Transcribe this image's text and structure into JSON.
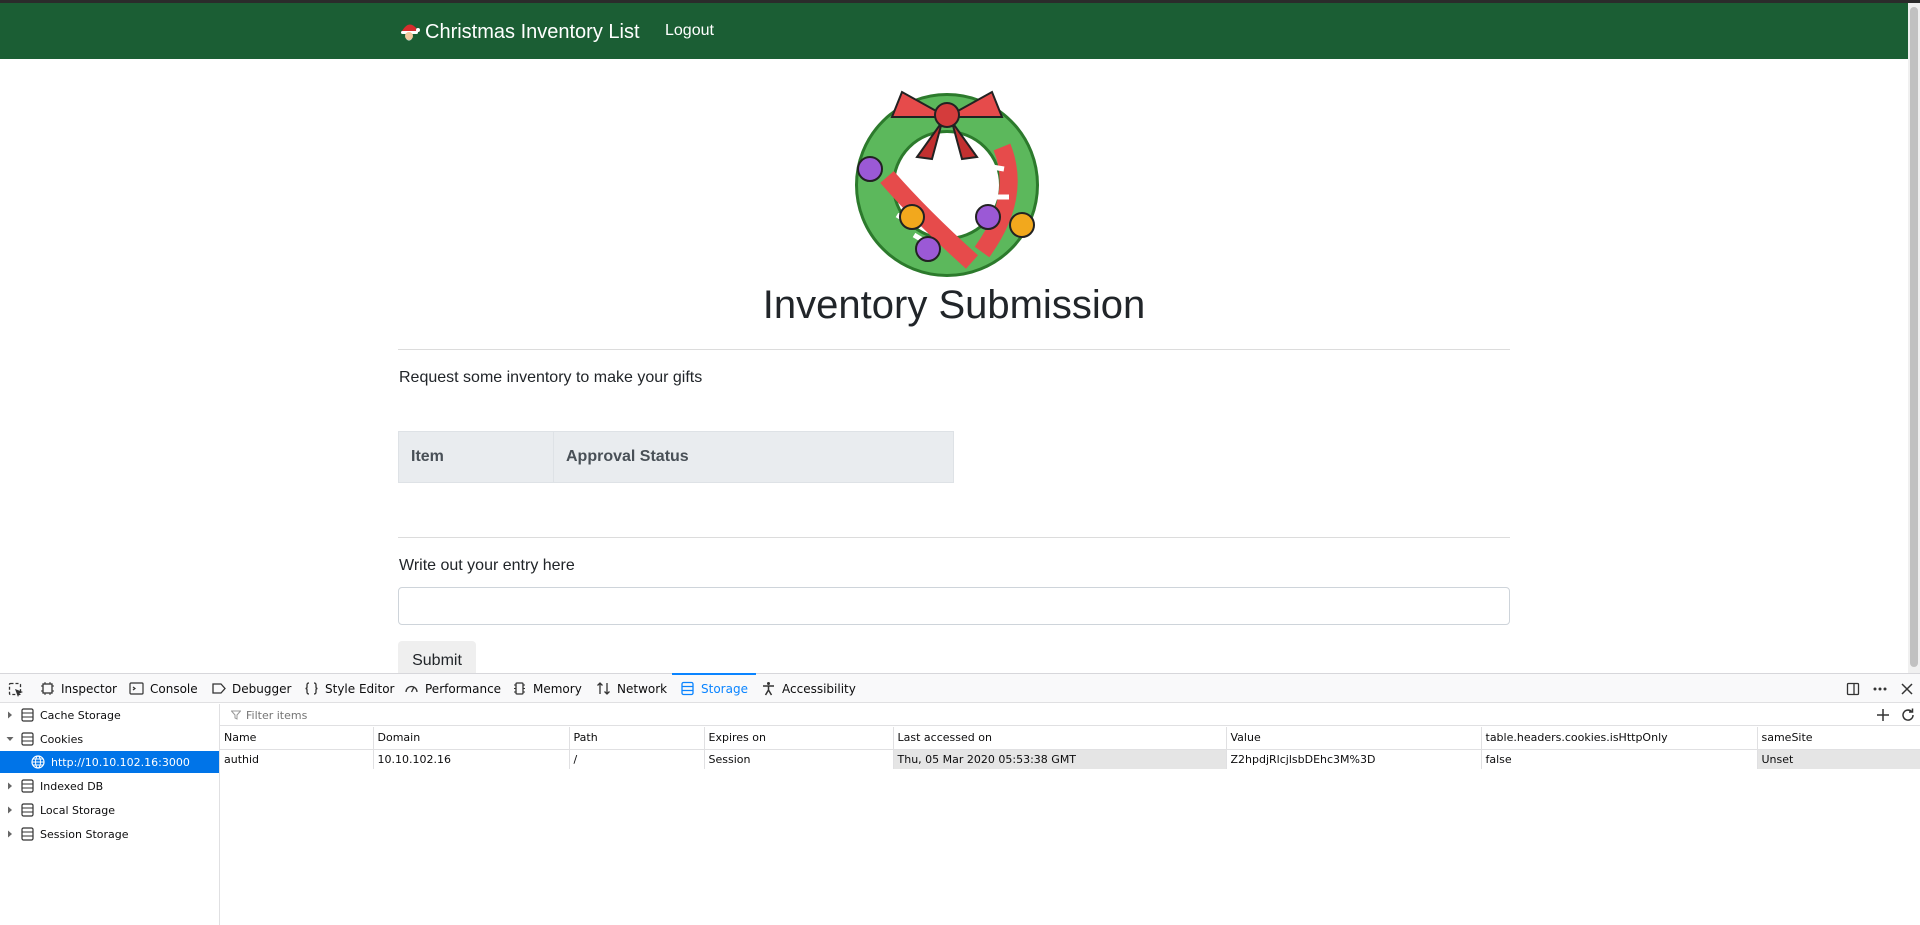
{
  "navbar": {
    "brand": "Christmas Inventory List",
    "logout": "Logout"
  },
  "main": {
    "title": "Inventory Submission",
    "lead": "Request some inventory to make your gifts",
    "table_headers": [
      "Item",
      "Approval Status"
    ],
    "entry_label": "Write out your entry here",
    "entry_value": "",
    "submit_label": "Submit"
  },
  "devtools": {
    "tabs": [
      "Inspector",
      "Console",
      "Debugger",
      "Style Editor",
      "Performance",
      "Memory",
      "Network",
      "Storage",
      "Accessibility"
    ],
    "selected_tab": "Storage",
    "sidebar": {
      "cache_storage": "Cache Storage",
      "cookies": "Cookies",
      "cookie_host": "http://10.10.102.16:3000",
      "indexed_db": "Indexed DB",
      "local_storage": "Local Storage",
      "session_storage": "Session Storage"
    },
    "filter_placeholder": "Filter items",
    "cookie_columns": [
      "Name",
      "Domain",
      "Path",
      "Expires on",
      "Last accessed on",
      "Value",
      "table.headers.cookies.isHttpOnly",
      "sameSite"
    ],
    "cookie_rows": [
      [
        "authid",
        "10.10.102.16",
        "/",
        "Session",
        "Thu, 05 Mar 2020 05:53:38 GMT",
        "Z2hpdjRlcjlsbDEhc3M%3D",
        "false",
        "Unset"
      ]
    ]
  },
  "colors": {
    "navbar_bg": "#1b5e34",
    "accent_blue": "#0a84ff",
    "selected_row": "#0074e8"
  }
}
